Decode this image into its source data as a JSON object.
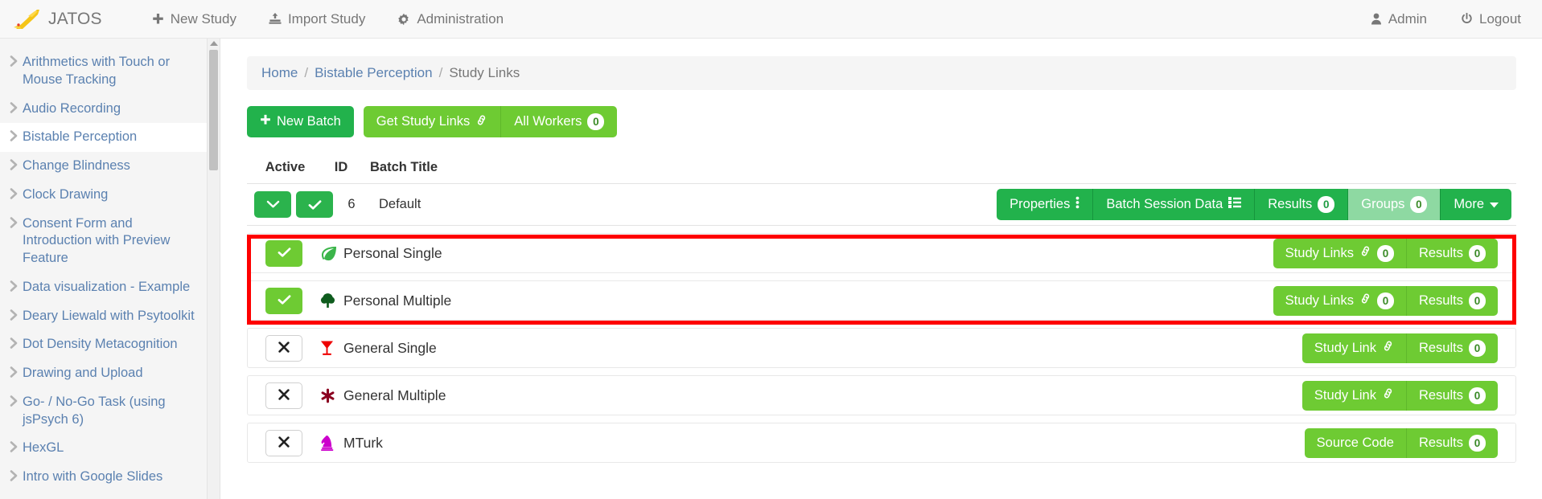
{
  "navbar": {
    "brand": "JATOS",
    "logo_icon": "jatos-rocket-logo",
    "items": [
      {
        "label": "New Study",
        "icon": "plus-icon"
      },
      {
        "label": "Import Study",
        "icon": "import-icon"
      },
      {
        "label": "Administration",
        "icon": "gear-icon"
      }
    ],
    "right_items": [
      {
        "label": "Admin",
        "icon": "user-icon"
      },
      {
        "label": "Logout",
        "icon": "power-icon"
      }
    ]
  },
  "sidebar": {
    "items": [
      {
        "label": "Arithmetics with Touch or Mouse Tracking",
        "active": false
      },
      {
        "label": "Audio Recording",
        "active": false
      },
      {
        "label": "Bistable Perception",
        "active": true
      },
      {
        "label": "Change Blindness",
        "active": false
      },
      {
        "label": "Clock Drawing",
        "active": false
      },
      {
        "label": "Consent Form and Introduction with Preview Feature",
        "active": false
      },
      {
        "label": "Data visualization - Example",
        "active": false
      },
      {
        "label": "Deary Liewald with Psytoolkit",
        "active": false
      },
      {
        "label": "Dot Density Metacognition",
        "active": false
      },
      {
        "label": "Drawing and Upload",
        "active": false
      },
      {
        "label": "Go- / No-Go Task (using jsPsych 6)",
        "active": false
      },
      {
        "label": "HexGL",
        "active": false
      },
      {
        "label": "Intro with Google Slides",
        "active": false
      }
    ]
  },
  "breadcrumb": {
    "home": "Home",
    "study": "Bistable Perception",
    "current": "Study Links",
    "separator": "/"
  },
  "toolbar": {
    "new_batch": "New Batch",
    "new_batch_icon": "plus-icon",
    "get_study_links": "Get Study Links",
    "get_study_links_icon": "link-icon",
    "all_workers": "All Workers",
    "all_workers_count": "0"
  },
  "table": {
    "headers": {
      "active": "Active",
      "id": "ID",
      "title": "Batch Title"
    }
  },
  "batch": {
    "expand_icon": "chevron-down-icon",
    "active_icon": "check-icon",
    "id": "6",
    "title": "Default",
    "actions": [
      {
        "label": "Properties",
        "icon": "vertical-dots-icon",
        "badge": null,
        "disabled": false
      },
      {
        "label": "Batch Session Data",
        "icon": "list-icon",
        "badge": null,
        "disabled": false
      },
      {
        "label": "Results",
        "icon": null,
        "badge": "0",
        "disabled": false
      },
      {
        "label": "Groups",
        "icon": null,
        "badge": "0",
        "disabled": true
      },
      {
        "label": "More",
        "icon": "caret-down-icon",
        "badge": null,
        "disabled": false
      }
    ]
  },
  "worker_types": [
    {
      "name": "Personal Single",
      "icon": "leaf-icon",
      "icon_color": "#3bb54a",
      "enabled": true,
      "toggle_icon": "check-icon",
      "actions": [
        {
          "label": "Study Links",
          "icon": "link-icon",
          "badge": "0"
        },
        {
          "label": "Results",
          "icon": null,
          "badge": "0"
        }
      ]
    },
    {
      "name": "Personal Multiple",
      "icon": "tree-icon",
      "icon_color": "#0f5c1e",
      "enabled": true,
      "toggle_icon": "check-icon",
      "actions": [
        {
          "label": "Study Links",
          "icon": "link-icon",
          "badge": "0"
        },
        {
          "label": "Results",
          "icon": null,
          "badge": "0"
        }
      ]
    },
    {
      "name": "General Single",
      "icon": "cocktail-glass-icon",
      "icon_color": "#ee0000",
      "enabled": false,
      "toggle_icon": "x-icon",
      "actions": [
        {
          "label": "Study Link",
          "icon": "link-icon",
          "badge": null
        },
        {
          "label": "Results",
          "icon": null,
          "badge": "0"
        }
      ]
    },
    {
      "name": "General Multiple",
      "icon": "asterisk-flower-icon",
      "icon_color": "#8b0020",
      "enabled": false,
      "toggle_icon": "x-icon",
      "actions": [
        {
          "label": "Study Link",
          "icon": "link-icon",
          "badge": null
        },
        {
          "label": "Results",
          "icon": null,
          "badge": "0"
        }
      ]
    },
    {
      "name": "MTurk",
      "icon": "chess-knight-icon",
      "icon_color": "#cc00cc",
      "enabled": false,
      "toggle_icon": "x-icon",
      "actions": [
        {
          "label": "Source Code",
          "icon": null,
          "badge": null
        },
        {
          "label": "Results",
          "icon": null,
          "badge": "0"
        }
      ]
    }
  ],
  "colors": {
    "brand_green_dark": "#22b24c",
    "brand_green_light": "#6ecb33",
    "link_blue": "#5b81b0",
    "highlight_red": "#fe0000"
  }
}
